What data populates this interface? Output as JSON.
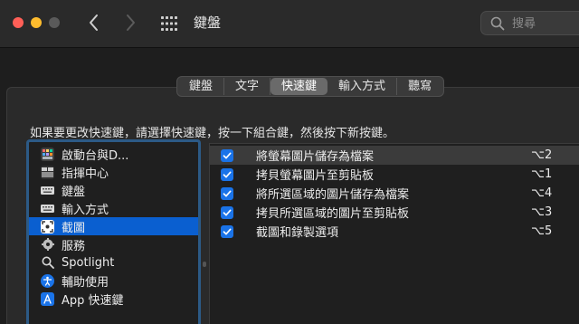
{
  "window": {
    "title": "鍵盤",
    "search_placeholder": "搜尋"
  },
  "tabs": [
    {
      "label": "鍵盤",
      "active": false
    },
    {
      "label": "文字",
      "active": false
    },
    {
      "label": "快速鍵",
      "active": true
    },
    {
      "label": "輸入方式",
      "active": false
    },
    {
      "label": "聽寫",
      "active": false
    }
  ],
  "instruction": "如果要更改快速鍵，請選擇快速鍵，按一下組合鍵，然後按下新按鍵。",
  "categories": [
    {
      "label": "啟動台與D...",
      "icon": "launchpad-icon",
      "selected": false
    },
    {
      "label": "指揮中心",
      "icon": "mission-control-icon",
      "selected": false
    },
    {
      "label": "鍵盤",
      "icon": "keyboard-icon",
      "selected": false
    },
    {
      "label": "輸入方式",
      "icon": "input-sources-icon",
      "selected": false
    },
    {
      "label": "截圖",
      "icon": "screenshot-icon",
      "selected": true
    },
    {
      "label": "服務",
      "icon": "services-gear-icon",
      "selected": false
    },
    {
      "label": "Spotlight",
      "icon": "spotlight-icon",
      "selected": false
    },
    {
      "label": "輔助使用",
      "icon": "accessibility-icon",
      "selected": false
    },
    {
      "label": "App 快速鍵",
      "icon": "app-shortcuts-icon",
      "selected": false
    }
  ],
  "shortcuts": [
    {
      "label": "將螢幕圖片儲存為檔案",
      "key": "⌥2",
      "checked": true,
      "highlighted": true
    },
    {
      "label": "拷貝螢幕圖片至剪貼板",
      "key": "⌥1",
      "checked": true,
      "highlighted": false
    },
    {
      "label": "將所選區域的圖片儲存為檔案",
      "key": "⌥4",
      "checked": true,
      "highlighted": false
    },
    {
      "label": "拷貝所選區域的圖片至剪貼板",
      "key": "⌥3",
      "checked": true,
      "highlighted": false
    },
    {
      "label": "截圖和錄製選項",
      "key": "⌥5",
      "checked": true,
      "highlighted": false
    }
  ],
  "colors": {
    "accent": "#0a5fd0",
    "checkbox": "#1a73e8",
    "close": "#ff5f57",
    "minimize": "#febc2e"
  }
}
